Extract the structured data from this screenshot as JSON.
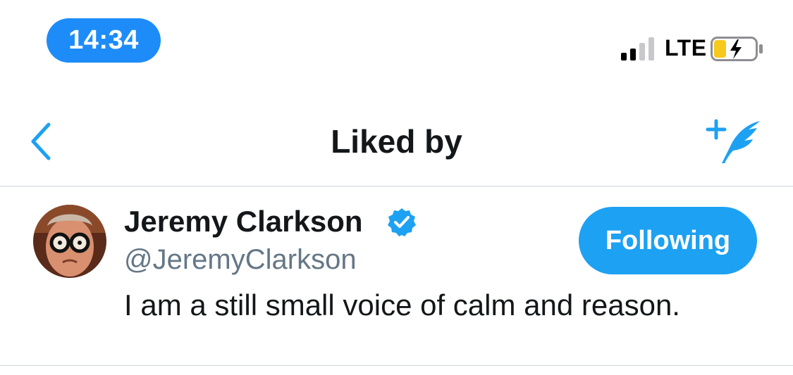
{
  "status_bar": {
    "time": "14:34",
    "network": "LTE",
    "signal_icon": "signal-bars-icon",
    "battery_icon": "battery-charging-icon",
    "colors": {
      "time_pill": "#1d8cf8",
      "battery_fill": "#f7c91c"
    }
  },
  "nav": {
    "title": "Liked by",
    "back_icon": "chevron-left-icon",
    "compose_icon": "compose-quill-icon",
    "accent": "#1da1f2"
  },
  "users": [
    {
      "name": "Jeremy Clarkson",
      "handle": "@JeremyClarkson",
      "bio": "I am a still small voice of calm and reason.",
      "verified": true,
      "follow_label": "Following",
      "avatar_icon": "avatar-photo"
    }
  ]
}
